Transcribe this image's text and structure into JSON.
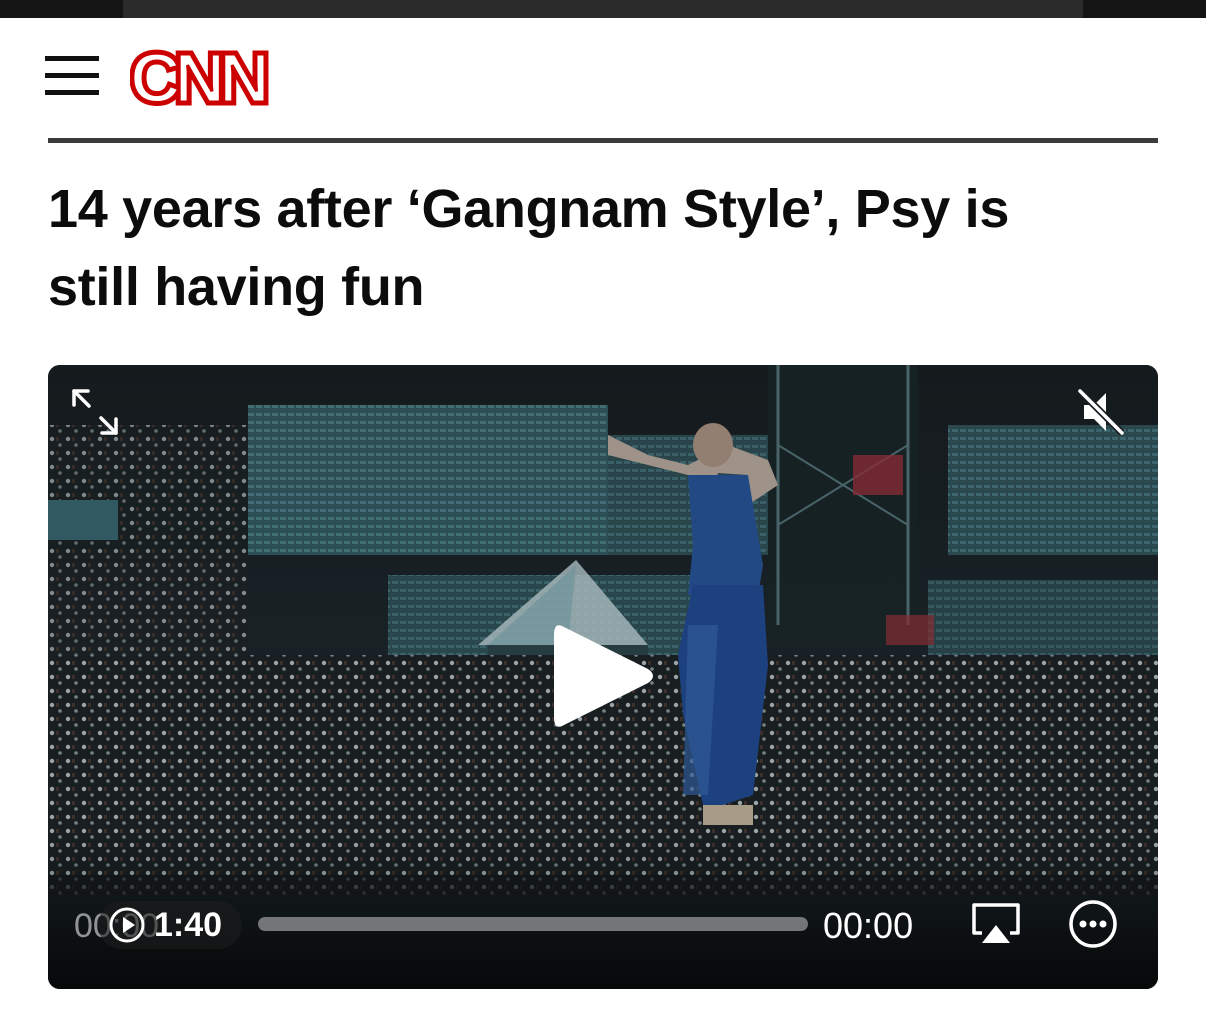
{
  "header": {
    "menu_icon": "hamburger-menu-icon",
    "logo_text": "CNN",
    "brand_color": "#cc0000"
  },
  "article": {
    "headline_line1": "14 years after ‘Gangnam Style’, Psy is",
    "headline_line2": "still having fun"
  },
  "video": {
    "thumbnail": "Psy performing on stage in a stadium, crowd holding light sticks",
    "controls": {
      "expand_icon": "expand-arrows-icon",
      "mute_icon": "muted-speaker-icon",
      "play_icon": "play-icon",
      "elapsed_obscured": "00:00",
      "duration_badge": "1:40",
      "remaining": "00:00",
      "progress": 0,
      "airplay_icon": "airplay-icon",
      "more_icon": "more-options-icon"
    }
  }
}
